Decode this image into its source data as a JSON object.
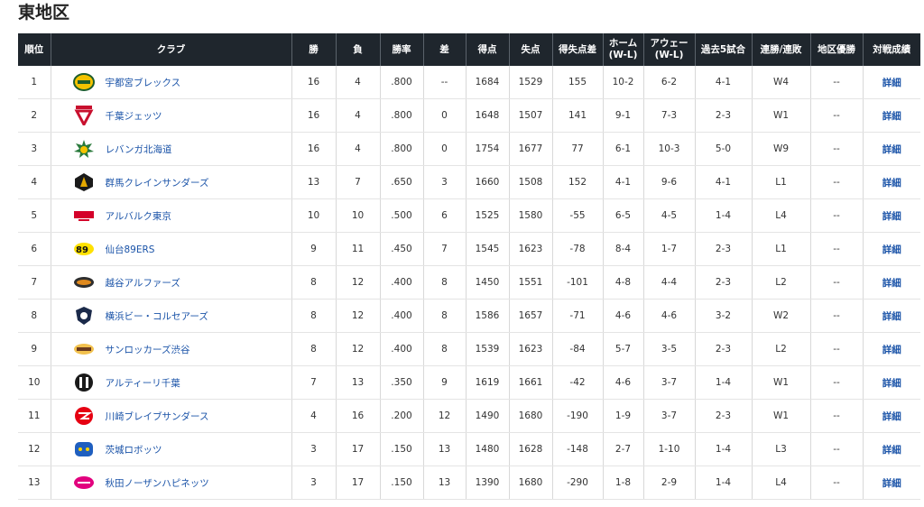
{
  "title": "東地区",
  "columns": [
    "順位",
    "クラブ",
    "勝",
    "負",
    "勝率",
    "差",
    "得点",
    "失点",
    "得失点差",
    "ホーム(W-L)",
    "アウェー(W-L)",
    "過去5試合",
    "連勝/連敗",
    "地区優勝",
    "対戦成績"
  ],
  "headers": {
    "rank": "順位",
    "club": "クラブ",
    "wins": "勝",
    "losses": "負",
    "pct": "勝率",
    "gb": "差",
    "pf": "得点",
    "pa": "失点",
    "diff": "得失点差",
    "home_line1": "ホーム",
    "home_line2": "(W-L)",
    "away_line1": "アウェー",
    "away_line2": "(W-L)",
    "last5": "過去5試合",
    "streak": "連勝/連敗",
    "clinch": "地区優勝",
    "h2h": "対戦成績"
  },
  "rows": [
    {
      "rank": "1",
      "club": "宇都宮ブレックス",
      "logo": "brex-logo-icon",
      "w": "16",
      "l": "4",
      "pct": ".800",
      "gb": "--",
      "pf": "1684",
      "pa": "1529",
      "diff": "155",
      "home": "10-2",
      "away": "6-2",
      "last5": "4-1",
      "streak": "W4",
      "clinch": "--",
      "h2h": "詳細"
    },
    {
      "rank": "2",
      "club": "千葉ジェッツ",
      "logo": "jets-logo-icon",
      "w": "16",
      "l": "4",
      "pct": ".800",
      "gb": "0",
      "pf": "1648",
      "pa": "1507",
      "diff": "141",
      "home": "9-1",
      "away": "7-3",
      "last5": "2-3",
      "streak": "W1",
      "clinch": "--",
      "h2h": "詳細"
    },
    {
      "rank": "3",
      "club": "レバンガ北海道",
      "logo": "levanga-logo-icon",
      "w": "16",
      "l": "4",
      "pct": ".800",
      "gb": "0",
      "pf": "1754",
      "pa": "1677",
      "diff": "77",
      "home": "6-1",
      "away": "10-3",
      "last5": "5-0",
      "streak": "W9",
      "clinch": "--",
      "h2h": "詳細"
    },
    {
      "rank": "4",
      "club": "群馬クレインサンダーズ",
      "logo": "thunders-logo-icon",
      "w": "13",
      "l": "7",
      "pct": ".650",
      "gb": "3",
      "pf": "1660",
      "pa": "1508",
      "diff": "152",
      "home": "4-1",
      "away": "9-6",
      "last5": "4-1",
      "streak": "L1",
      "clinch": "--",
      "h2h": "詳細"
    },
    {
      "rank": "5",
      "club": "アルバルク東京",
      "logo": "alvark-logo-icon",
      "w": "10",
      "l": "10",
      "pct": ".500",
      "gb": "6",
      "pf": "1525",
      "pa": "1580",
      "diff": "-55",
      "home": "6-5",
      "away": "4-5",
      "last5": "1-4",
      "streak": "L4",
      "clinch": "--",
      "h2h": "詳細"
    },
    {
      "rank": "6",
      "club": "仙台89ERS",
      "logo": "89ers-logo-icon",
      "w": "9",
      "l": "11",
      "pct": ".450",
      "gb": "7",
      "pf": "1545",
      "pa": "1623",
      "diff": "-78",
      "home": "8-4",
      "away": "1-7",
      "last5": "2-3",
      "streak": "L1",
      "clinch": "--",
      "h2h": "詳細"
    },
    {
      "rank": "7",
      "club": "越谷アルファーズ",
      "logo": "alphas-logo-icon",
      "w": "8",
      "l": "12",
      "pct": ".400",
      "gb": "8",
      "pf": "1450",
      "pa": "1551",
      "diff": "-101",
      "home": "4-8",
      "away": "4-4",
      "last5": "2-3",
      "streak": "L2",
      "clinch": "--",
      "h2h": "詳細"
    },
    {
      "rank": "8",
      "club": "横浜ビー・コルセアーズ",
      "logo": "corsairs-logo-icon",
      "w": "8",
      "l": "12",
      "pct": ".400",
      "gb": "8",
      "pf": "1586",
      "pa": "1657",
      "diff": "-71",
      "home": "4-6",
      "away": "4-6",
      "last5": "3-2",
      "streak": "W2",
      "clinch": "--",
      "h2h": "詳細"
    },
    {
      "rank": "9",
      "club": "サンロッカーズ渋谷",
      "logo": "sunrockers-logo-icon",
      "w": "8",
      "l": "12",
      "pct": ".400",
      "gb": "8",
      "pf": "1539",
      "pa": "1623",
      "diff": "-84",
      "home": "5-7",
      "away": "3-5",
      "last5": "2-3",
      "streak": "L2",
      "clinch": "--",
      "h2h": "詳細"
    },
    {
      "rank": "10",
      "club": "アルティーリ千葉",
      "logo": "altiri-logo-icon",
      "w": "7",
      "l": "13",
      "pct": ".350",
      "gb": "9",
      "pf": "1619",
      "pa": "1661",
      "diff": "-42",
      "home": "4-6",
      "away": "3-7",
      "last5": "1-4",
      "streak": "W1",
      "clinch": "--",
      "h2h": "詳細"
    },
    {
      "rank": "11",
      "club": "川崎ブレイブサンダース",
      "logo": "brave-thunders-logo-icon",
      "w": "4",
      "l": "16",
      "pct": ".200",
      "gb": "12",
      "pf": "1490",
      "pa": "1680",
      "diff": "-190",
      "home": "1-9",
      "away": "3-7",
      "last5": "2-3",
      "streak": "W1",
      "clinch": "--",
      "h2h": "詳細"
    },
    {
      "rank": "12",
      "club": "茨城ロボッツ",
      "logo": "robots-logo-icon",
      "w": "3",
      "l": "17",
      "pct": ".150",
      "gb": "13",
      "pf": "1480",
      "pa": "1628",
      "diff": "-148",
      "home": "2-7",
      "away": "1-10",
      "last5": "1-4",
      "streak": "L3",
      "clinch": "--",
      "h2h": "詳細"
    },
    {
      "rank": "13",
      "club": "秋田ノーザンハピネッツ",
      "logo": "happinets-logo-icon",
      "w": "3",
      "l": "17",
      "pct": ".150",
      "gb": "13",
      "pf": "1390",
      "pa": "1680",
      "diff": "-290",
      "home": "1-8",
      "away": "2-9",
      "last5": "1-4",
      "streak": "L4",
      "clinch": "--",
      "h2h": "詳細"
    }
  ],
  "colors": {
    "header_bg": "#1f262d",
    "link": "#1a53a8"
  }
}
